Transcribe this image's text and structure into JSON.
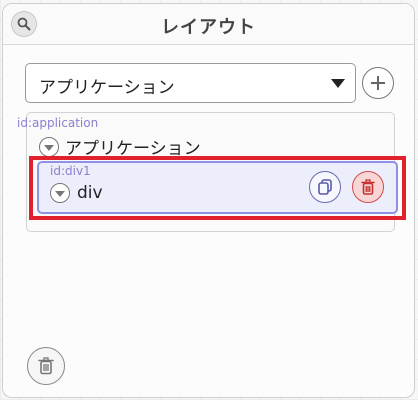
{
  "panel": {
    "title": "レイアウト"
  },
  "component_select": {
    "selected": "アプリケーション"
  },
  "tree": {
    "root": {
      "id_label": "id:application",
      "name": "アプリケーション"
    },
    "child": {
      "id_label": "id:div1",
      "name": "div"
    }
  },
  "icons": {
    "search": "search-icon",
    "add": "plus-icon",
    "copy": "copy-icon",
    "delete": "trash-icon"
  },
  "colors": {
    "highlight": "#e0202a",
    "selected_node_border": "#8f92e4",
    "selected_node_bg": "#eceefc",
    "id_text": "#8d7fd0",
    "delete": "#d44b4b"
  }
}
